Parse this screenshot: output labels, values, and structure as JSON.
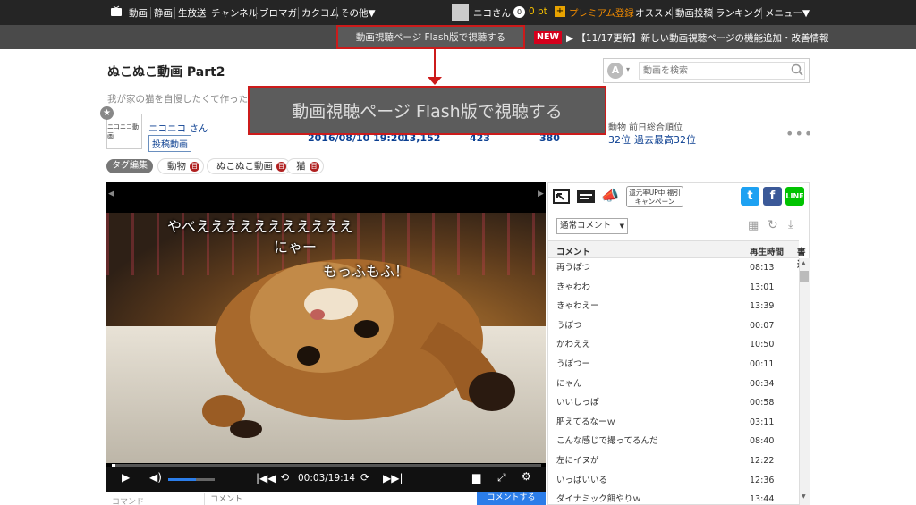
{
  "nav": {
    "items": [
      "動画",
      "静画",
      "生放送",
      "チャンネル",
      "ブロマガ",
      "カクヨム",
      "その他▼"
    ],
    "user": "ニコさん",
    "points": "0 pt",
    "premium": "プレミアム登録",
    "right": [
      "オススメ",
      "動画投稿",
      "ランキング",
      "メニュー▼"
    ]
  },
  "subbar": {
    "flash_label": "動画視聴ページ Flash版で視聴する",
    "new_badge": "NEW",
    "news": "▶ 【11/17更新】新しい動画視聴ページの機能追加・改善情報"
  },
  "callout": "動画視聴ページ Flash版で視聴する",
  "video": {
    "title": "ぬこぬこ動画 Part2",
    "description": "我が家の猫を自慢したくて作った。後悔",
    "search_placeholder": "動画を検索",
    "search_select": "A",
    "owner": "ニコニコ さん",
    "avatar_text": "ニコニコ動画",
    "post_label": "投稿動画",
    "posted": "2016/08/10 19:20",
    "views": "13,152",
    "comments": "423",
    "mylists": "380",
    "genre_label": "動物",
    "rank_label": "前日総合順位",
    "rank": "32位",
    "best": "過去最高32位"
  },
  "tags": {
    "edit": "タグ編集",
    "items": [
      "動物",
      "ぬこぬこ動画",
      "猫"
    ],
    "dic": "百"
  },
  "player": {
    "comments": [
      "やべえええええええええええ",
      "にゃー",
      "もっふもふ！"
    ],
    "time": "00:03/19:14",
    "progress": 0.003,
    "volume": 0.6,
    "cmd_label": "コマンド",
    "comment_placeholder": "コメント",
    "submit": "コメントする"
  },
  "panel": {
    "campaign": "還元率UP中 福引キャンペーン",
    "sort": "通常コメント",
    "col_comment": "コメント",
    "col_time": "再生時間",
    "col_extra": "書込",
    "rows": [
      [
        "再うぽつ",
        "08:13"
      ],
      [
        "きゃわわ",
        "13:01"
      ],
      [
        "きゃわえー",
        "13:39"
      ],
      [
        "うぽつ",
        "00:07"
      ],
      [
        "かわええ",
        "10:50"
      ],
      [
        "うぽつー",
        "00:11"
      ],
      [
        "にゃん",
        "00:34"
      ],
      [
        "いいしっぽ",
        "00:58"
      ],
      [
        "肥えてるなーｗ",
        "03:11"
      ],
      [
        "こんな感じで撮ってるんだ",
        "08:40"
      ],
      [
        "左にイヌが",
        "12:22"
      ],
      [
        "いっぱいいる",
        "12:36"
      ],
      [
        "ダイナミック餌やりｗ",
        "13:44"
      ]
    ]
  },
  "colors": {
    "accent": "#cc1b1b",
    "link": "#0b3f91",
    "submit": "#2b7de9"
  }
}
